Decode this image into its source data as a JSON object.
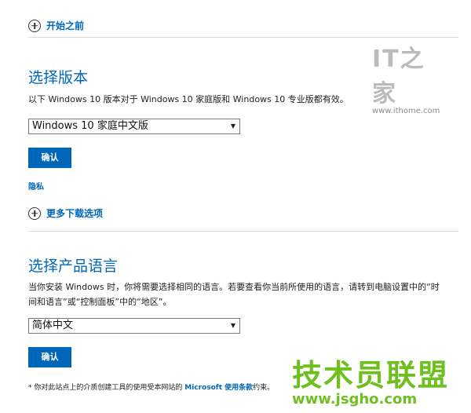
{
  "before_start": {
    "label": "开始之前"
  },
  "edition_section": {
    "heading": "选择版本",
    "description": "以下 Windows 10 版本对于 Windows 10 家庭版和 Windows 10 专业版都有效。",
    "selected": "Windows 10 家庭中文版",
    "confirm_label": "确认",
    "privacy_label": "隐私"
  },
  "more_options": {
    "label": "更多下载选项"
  },
  "language_section": {
    "heading": "选择产品语言",
    "description_line1": "当你安装 Windows 时，你将需要选择相同的语言。若要查看你当前所使用的语言，请转到电脑设置中的“时",
    "description_line2": "间和语言”或“控制面板”中的“地区”。",
    "selected": "简体中文",
    "confirm_label": "确认"
  },
  "footnote": {
    "prefix": "* 你对此站点上的介质创建工具的使用受本网站的 ",
    "link": "Microsoft 使用条款",
    "suffix": "约束。"
  },
  "watermark_top": {
    "logo": "IT之家",
    "url": "www.ithome.com"
  },
  "watermark_bottom": {
    "title": "技术员联盟",
    "url": "www.jsgho.com"
  },
  "colors": {
    "accent": "#0067b8",
    "watermark_green": "#6fbf1e"
  },
  "icons": {
    "expand": "plus-circle-icon",
    "dropdown": "caret-down-icon"
  }
}
